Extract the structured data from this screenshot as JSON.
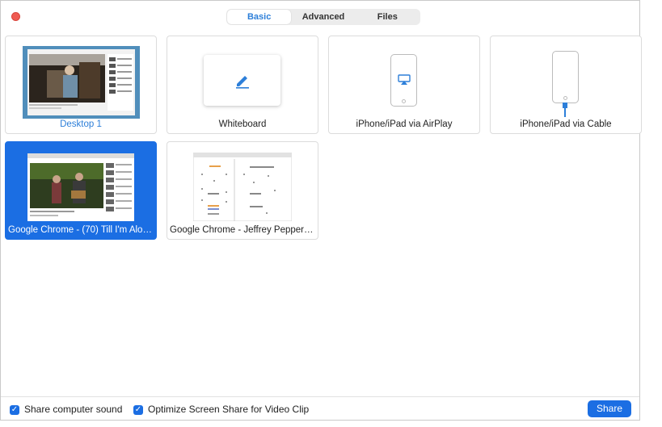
{
  "tabs": [
    {
      "label": "Basic",
      "active": true
    },
    {
      "label": "Advanced",
      "active": false
    },
    {
      "label": "Files",
      "active": false
    }
  ],
  "tiles": [
    {
      "label": "Desktop 1",
      "kind": "desktop"
    },
    {
      "label": "Whiteboard",
      "kind": "whiteboard"
    },
    {
      "label": "iPhone/iPad via AirPlay",
      "kind": "airplay"
    },
    {
      "label": "iPhone/iPad via Cable",
      "kind": "cable"
    },
    {
      "label": "Google Chrome - (70) Till I'm Alon...",
      "kind": "window",
      "selected": true
    },
    {
      "label": "Google Chrome - Jeffrey Pepper R...",
      "kind": "window"
    }
  ],
  "footer": {
    "share_sound_label": "Share computer sound",
    "share_sound_checked": true,
    "optimize_label": "Optimize Screen Share for Video Clip",
    "optimize_checked": true,
    "share_button": "Share"
  },
  "colors": {
    "accent": "#1b6ee3",
    "close": "#ef5b52"
  }
}
